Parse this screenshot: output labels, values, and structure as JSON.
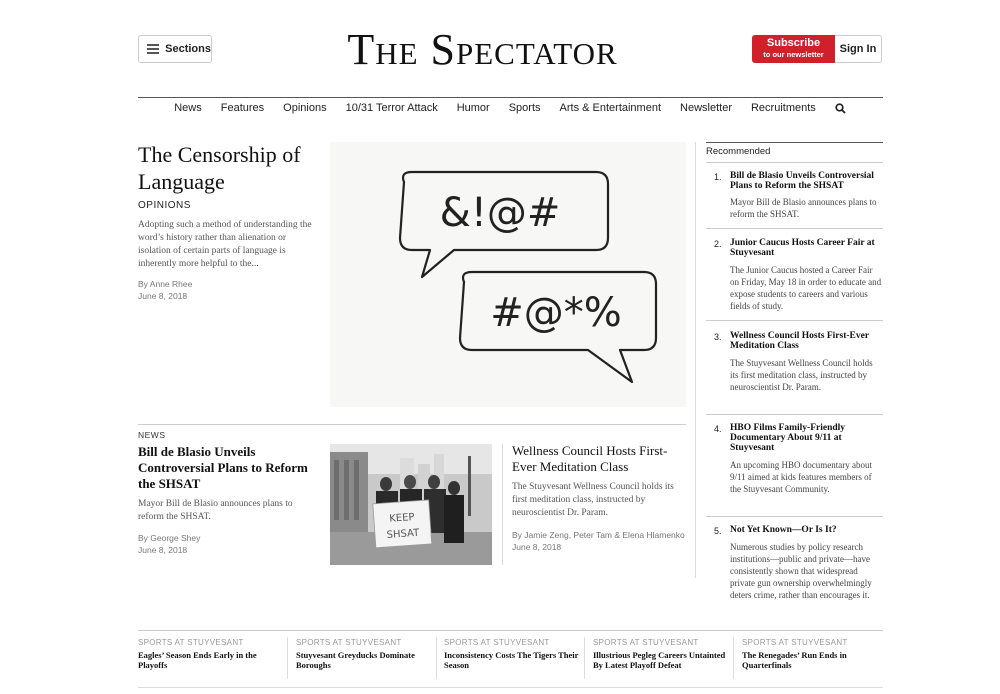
{
  "header": {
    "sections_label": "Sections",
    "masthead": "The Spectator",
    "subscribe_line1": "Subscribe",
    "subscribe_line2": "to our newsletter",
    "signin_label": "Sign In"
  },
  "nav": {
    "items": [
      "News",
      "Features",
      "Opinions",
      "10/31 Terror Attack",
      "Humor",
      "Sports",
      "Arts & Entertainment",
      "Newsletter",
      "Recruitments"
    ],
    "search_icon": "search-icon"
  },
  "lead": {
    "title": "The Censorship of Language",
    "section": "OPINIONS",
    "summary": "Adopting such a method of understanding the word’s history rather than alienation or isolation of certain parts of language is inherently more helpful to the...",
    "byline": "By Anne Rhee",
    "date": "June 8, 2018",
    "bubble1_text": "&!@#",
    "bubble2_text": "#@*%"
  },
  "story2": {
    "section": "NEWS",
    "title": "Bill de Blasio Unveils Controversial Plans to Reform the SHSAT",
    "summary": "Mayor Bill de Blasio announces plans to reform the SHSAT.",
    "byline": "By George Shey",
    "date": "June 8, 2018",
    "sign_line1": "KEEP",
    "sign_line2": "SHSAT"
  },
  "story3": {
    "title": "Wellness Council Hosts First-Ever Meditation Class",
    "summary": "The Stuyvesant Wellness Council holds its first meditation class, instructed by neuroscientist Dr. Param.",
    "byline": "By Jamie Zeng, Peter Tam & Elena Hlamenko",
    "date": "June 8, 2018"
  },
  "recommended": {
    "heading": "Recommended",
    "items": [
      {
        "num": "1.",
        "title": "Bill de Blasio Unveils Controversial Plans to Reform the SHSAT",
        "summary": "Mayor Bill de Blasio announces plans to reform the SHSAT."
      },
      {
        "num": "2.",
        "title": "Junior Caucus Hosts Career Fair at Stuyvesant",
        "summary": "The Junior Caucus hosted a Career Fair on Friday, May 18 in order to educate and expose students to careers and various fields of study."
      },
      {
        "num": "3.",
        "title": "Wellness Council Hosts First-Ever Meditation Class",
        "summary": "The Stuyvesant Wellness Council holds its first meditation class, instructed by neuroscientist Dr. Param."
      },
      {
        "num": "4.",
        "title": "HBO Films Family-Friendly Documentary About 9/11 at Stuyvesant",
        "summary": "An upcoming HBO documentary about 9/11 aimed at kids features members of the Stuyvesant Community."
      },
      {
        "num": "5.",
        "title": "Not Yet Known—Or Is It?",
        "summary": "Numerous studies by policy research institutions—public and private—have consistently shown that widespread private gun ownership overwhelmingly deters crime, rather than encourages it."
      }
    ]
  },
  "sports": {
    "kicker": "SPORTS AT STUYVESANT",
    "items": [
      {
        "title": "Eagles’ Season Ends Early in the Playoffs"
      },
      {
        "title": "Stuyvesant Greyducks Dominate Boroughs"
      },
      {
        "title": "Inconsistency Costs The Tigers Their Season"
      },
      {
        "title": "Illustrious Pegleg Careers Untainted By Latest Playoff Defeat"
      },
      {
        "title": "The Renegades’ Run Ends in Quarterfinals"
      }
    ]
  }
}
